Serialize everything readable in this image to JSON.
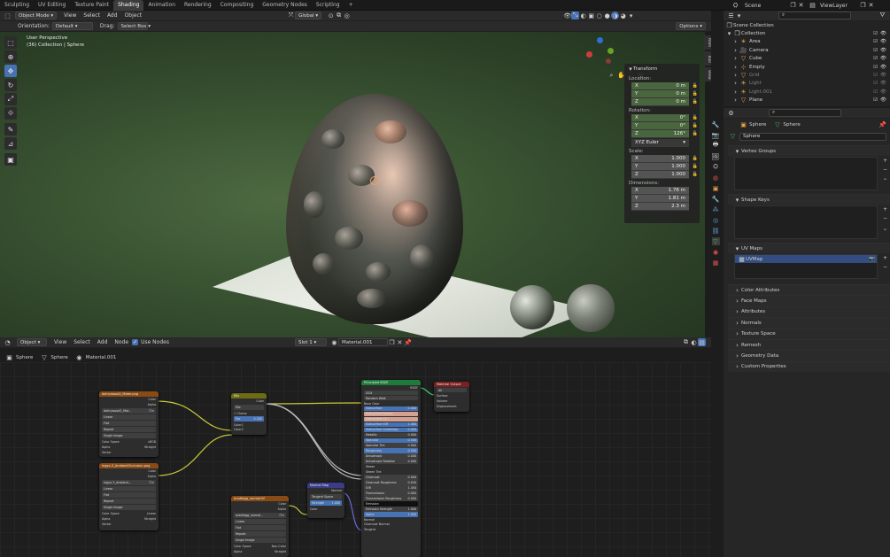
{
  "workspace_tabs": [
    "Sculpting",
    "UV Editing",
    "Texture Paint",
    "Shading",
    "Animation",
    "Rendering",
    "Compositing",
    "Geometry Nodes",
    "Scripting"
  ],
  "active_tab": "Shading",
  "add_tab": "+",
  "scene_name": "Scene",
  "view_layer": "ViewLayer",
  "viewport": {
    "mode": "Object Mode",
    "menus": [
      "View",
      "Select",
      "Add",
      "Object"
    ],
    "transform_orientation": "Global",
    "orientation_label": "Orientation:",
    "orientation_value": "Default",
    "drag_label": "Drag:",
    "drag_value": "Select Box",
    "options": "Options",
    "view_name": "User Perspective",
    "view_sub": "(36) Collection | Sphere",
    "side_tabs": [
      "Item",
      "Tool",
      "View"
    ]
  },
  "transform_panel": {
    "title": "Transform",
    "location_label": "Location:",
    "location": [
      {
        "axis": "X",
        "value": "0 m"
      },
      {
        "axis": "Y",
        "value": "0 m"
      },
      {
        "axis": "Z",
        "value": "0 m"
      }
    ],
    "rotation_label": "Rotation:",
    "rotation": [
      {
        "axis": "X",
        "value": "0°"
      },
      {
        "axis": "Y",
        "value": "0°"
      },
      {
        "axis": "Z",
        "value": "126°"
      }
    ],
    "rotation_mode": "XYZ Euler",
    "scale_label": "Scale:",
    "scale": [
      {
        "axis": "X",
        "value": "1.000"
      },
      {
        "axis": "Y",
        "value": "1.000"
      },
      {
        "axis": "Z",
        "value": "1.000"
      }
    ],
    "dimensions_label": "Dimensions:",
    "dimensions": [
      {
        "axis": "X",
        "value": "1.76 m"
      },
      {
        "axis": "Y",
        "value": "1.81 m"
      },
      {
        "axis": "Z",
        "value": "2.3 m"
      }
    ]
  },
  "node_editor": {
    "type": "Object",
    "menus": [
      "View",
      "Select",
      "Add",
      "Node"
    ],
    "use_nodes": "Use Nodes",
    "slot": "Slot 1",
    "material": "Material.001",
    "breadcrumb": [
      "Sphere",
      "Sphere",
      "Material.001"
    ]
  },
  "nodes": {
    "img1": {
      "title": "dohrywood2_Mater.png",
      "file": "dohrywood2_Mat...",
      "opts": [
        "Linear",
        "Flat",
        "Repeat",
        "Single Image"
      ],
      "cs_label": "Color Space",
      "cs_val": "sRGB",
      "alpha_label": "Alpha",
      "alpha_val": "Straight",
      "out": [
        "Color",
        "Alpha"
      ],
      "in": "Vector"
    },
    "img2": {
      "title": "ingyo-3_AmbientOcclusion.png",
      "file": "ingyo-3_Ambient...",
      "opts": [
        "Linear",
        "Flat",
        "Repeat",
        "Single Image"
      ],
      "cs_label": "Color Space",
      "cs_val": "Linear",
      "alpha_label": "Alpha",
      "alpha_val": "Straight",
      "out": [
        "Color",
        "Alpha"
      ],
      "in": "Vector"
    },
    "img3": {
      "title": "aradtbgg_normal.tif",
      "file": "aradtbgg_normal...",
      "opts": [
        "Linear",
        "Flat",
        "Repeat",
        "Single Image"
      ],
      "cs_label": "Color Space",
      "cs_val": "Non-Color",
      "alpha_label": "Alpha",
      "alpha_val": "Straight",
      "out": [
        "Color",
        "Alpha"
      ],
      "in": "Vector"
    },
    "mix": {
      "title": "Mix",
      "out": "Color",
      "mode": "Mix",
      "blend": "Mix",
      "clamp": "Clamp",
      "fac_label": "Fac",
      "fac": "0.500",
      "in": [
        "Color1",
        "Color2"
      ]
    },
    "normal": {
      "title": "Normal Map",
      "out": "Normal",
      "space": "Tangent Space",
      "strength_label": "Strength",
      "strength": "1.000",
      "in": "Color"
    },
    "bsdf": {
      "title": "Principled BSDF",
      "out": "BSDF",
      "dist": "GGX",
      "sss": "Random Walk",
      "base": "Base Color",
      "rows": [
        [
          "Subsurface",
          "0.000"
        ],
        [
          "Subsurface Radius",
          ""
        ],
        [
          "Subsurface Co...",
          ""
        ],
        [
          "Subsurface IOR",
          "1.400"
        ],
        [
          "Subsurface Anisotropy",
          "0.000"
        ],
        [
          "Metallic",
          "0.000"
        ],
        [
          "Specular",
          "0.500"
        ],
        [
          "Specular Tint",
          "0.000"
        ],
        [
          "Roughness",
          "0.500"
        ],
        [
          "Anisotropic",
          "0.000"
        ],
        [
          "Anisotropic Rotation",
          "0.000"
        ]
      ],
      "rows2": [
        [
          "Sheen",
          ""
        ],
        [
          "Sheen Tint",
          ""
        ],
        [
          "Clearcoat",
          "0.000"
        ],
        [
          "Clearcoat Roughness",
          "0.030"
        ],
        [
          "IOR",
          "1.450"
        ],
        [
          "Transmission",
          "0.000"
        ],
        [
          "Transmission Roughness",
          "0.000"
        ],
        [
          "Emission",
          ""
        ],
        [
          "Emission Strength",
          "1.000"
        ],
        [
          "Alpha",
          "1.000"
        ]
      ],
      "tail": [
        "Normal",
        "Clearcoat Normal",
        "Tangent"
      ]
    },
    "output": {
      "title": "Material Output",
      "target": "All",
      "in": [
        "Surface",
        "Volume",
        "Displacement"
      ]
    }
  },
  "outliner": {
    "root": "Scene Collection",
    "collection": "Collection",
    "items": [
      "Area",
      "Camera",
      "Cube",
      "Empty",
      "Grid",
      "Light",
      "Light.001",
      "Plane"
    ]
  },
  "properties": {
    "breadcrumb": [
      "Sphere",
      "Sphere"
    ],
    "mesh_name": "Sphere",
    "panels": {
      "vertex_groups": "Vertex Groups",
      "shape_keys": "Shape Keys",
      "uv_maps": "UV Maps"
    },
    "uv_map": "UVMap",
    "collapsed": [
      "Color Attributes",
      "Face Maps",
      "Attributes",
      "Normals",
      "Texture Space",
      "Remesh",
      "Geometry Data",
      "Custom Properties"
    ]
  },
  "colors": {
    "accent": "#4772b3",
    "green_field": "#49663e",
    "image_node": "#8a4a13",
    "mix_node": "#6d6b14",
    "vector_node": "#3b3b8a",
    "shader_node": "#1f7a3c",
    "output_node": "#7b2020"
  }
}
